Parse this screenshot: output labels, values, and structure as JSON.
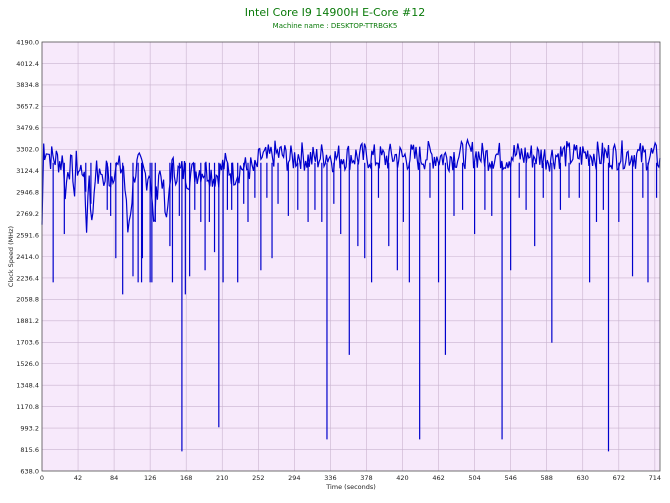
{
  "chart_data": {
    "type": "line",
    "title": "Intel Core I9 14900H E-Core #12",
    "subtitle": "Machine name : DESKTOP-TTRBGK5",
    "xlabel": "Time (seconds)",
    "ylabel": "Clock Speed (MHz)",
    "xlim": [
      0,
      720
    ],
    "ylim": [
      638.0,
      4190.0
    ],
    "x_ticks": [
      "0",
      "42",
      "84",
      "126",
      "168",
      "210",
      "252",
      "294",
      "336",
      "378",
      "420",
      "462",
      "504",
      "546",
      "588",
      "630",
      "672",
      "714"
    ],
    "y_ticks": [
      "638.0",
      "815.6",
      "993.2",
      "1170.8",
      "1348.4",
      "1526.0",
      "1703.6",
      "1881.2",
      "2058.8",
      "2236.4",
      "2414.0",
      "2591.6",
      "2769.2",
      "2946.8",
      "3124.4",
      "3302.0",
      "3479.6",
      "3657.2",
      "3834.8",
      "4012.4",
      "4190.0"
    ],
    "grid": true,
    "series": [
      {
        "color": "#0000cc",
        "baseline": 3190,
        "upper_level": 3300,
        "x": [
          0,
          2,
          3,
          5,
          7,
          10,
          14,
          18,
          22,
          25,
          27,
          30,
          32,
          36,
          38,
          40,
          44,
          48,
          52,
          55,
          58,
          62,
          67,
          70,
          72,
          75,
          80,
          84,
          90,
          95,
          100,
          108,
          112,
          116,
          122,
          126,
          130,
          136,
          140,
          145,
          150,
          160,
          166,
          170,
          178,
          185,
          194,
          200,
          206,
          212,
          218,
          222,
          228,
          234,
          240,
          248,
          255,
          262,
          270,
          280,
          290,
          300,
          310,
          320,
          330,
          340,
          350,
          360,
          370,
          380,
          390,
          400,
          410,
          420,
          430,
          440,
          450,
          460,
          470,
          480,
          490,
          500,
          510,
          520,
          530,
          540,
          550,
          560,
          570,
          580,
          590,
          600,
          610,
          620,
          630,
          640,
          650,
          660,
          670,
          680,
          690,
          700,
          710,
          720
        ],
        "y": [
          2210,
          3520,
          3460,
          3500,
          3400,
          3330,
          3300,
          3290,
          3240,
          3300,
          2600,
          3230,
          3170,
          3100,
          2700,
          3210,
          3080,
          3170,
          2200,
          3100,
          2150,
          3120,
          2950,
          3160,
          2800,
          3140,
          2970,
          3150,
          3130,
          3160,
          2100,
          3080,
          3190,
          3120,
          3000,
          3110,
          2150,
          3090,
          3000,
          2150,
          3150,
          3060,
          3100,
          3000,
          3080,
          3120,
          3100,
          3010,
          3060,
          3200,
          3140,
          3050,
          3100,
          3170,
          3080,
          3000,
          3250,
          3200,
          3290,
          3280,
          3200,
          3290,
          3210,
          3220,
          3300,
          3220,
          3260,
          3260,
          3250,
          3260,
          3220,
          3220,
          3260,
          3240,
          3250,
          3230,
          3280,
          3260,
          3240,
          3270,
          3280,
          3300,
          3270,
          3250,
          3280,
          3230,
          3290,
          3270,
          3260,
          3260,
          3240,
          3280,
          3290,
          3260,
          3280,
          3300,
          3260,
          3280,
          3270,
          3290,
          3280,
          3250,
          3270,
          3230
        ],
        "dips": [
          {
            "x": 13,
            "min": 2200
          },
          {
            "x": 26,
            "min": 2600
          },
          {
            "x": 51,
            "min": 2950
          },
          {
            "x": 57,
            "min": 2850
          },
          {
            "x": 76,
            "min": 2800
          },
          {
            "x": 80,
            "min": 2750
          },
          {
            "x": 86,
            "min": 2400
          },
          {
            "x": 94,
            "min": 2100
          },
          {
            "x": 106,
            "min": 2250
          },
          {
            "x": 112,
            "min": 2200
          },
          {
            "x": 116,
            "min": 2200
          },
          {
            "x": 117,
            "min": 2400
          },
          {
            "x": 126,
            "min": 2200
          },
          {
            "x": 128,
            "min": 2200
          },
          {
            "x": 132,
            "min": 2700
          },
          {
            "x": 149,
            "min": 2500
          },
          {
            "x": 152,
            "min": 2200
          },
          {
            "x": 160,
            "min": 2750
          },
          {
            "x": 163,
            "min": 800
          },
          {
            "x": 167,
            "min": 2100
          },
          {
            "x": 172,
            "min": 2250
          },
          {
            "x": 178,
            "min": 2800
          },
          {
            "x": 185,
            "min": 2700
          },
          {
            "x": 190,
            "min": 2300
          },
          {
            "x": 195,
            "min": 2700
          },
          {
            "x": 201,
            "min": 2450
          },
          {
            "x": 206,
            "min": 1000
          },
          {
            "x": 211,
            "min": 2200
          },
          {
            "x": 216,
            "min": 2800
          },
          {
            "x": 221,
            "min": 2800
          },
          {
            "x": 228,
            "min": 2200
          },
          {
            "x": 235,
            "min": 2850
          },
          {
            "x": 240,
            "min": 2700
          },
          {
            "x": 248,
            "min": 2900
          },
          {
            "x": 255,
            "min": 2300
          },
          {
            "x": 262,
            "min": 2900
          },
          {
            "x": 268,
            "min": 2400
          },
          {
            "x": 275,
            "min": 2850
          },
          {
            "x": 287,
            "min": 2750
          },
          {
            "x": 298,
            "min": 2800
          },
          {
            "x": 310,
            "min": 2700
          },
          {
            "x": 318,
            "min": 2800
          },
          {
            "x": 326,
            "min": 2700
          },
          {
            "x": 332,
            "min": 900
          },
          {
            "x": 340,
            "min": 2850
          },
          {
            "x": 348,
            "min": 2600
          },
          {
            "x": 358,
            "min": 1600
          },
          {
            "x": 368,
            "min": 2500
          },
          {
            "x": 376,
            "min": 2400
          },
          {
            "x": 384,
            "min": 2200
          },
          {
            "x": 392,
            "min": 2900
          },
          {
            "x": 404,
            "min": 2500
          },
          {
            "x": 414,
            "min": 2300
          },
          {
            "x": 421,
            "min": 2700
          },
          {
            "x": 428,
            "min": 2200
          },
          {
            "x": 440,
            "min": 900
          },
          {
            "x": 452,
            "min": 2900
          },
          {
            "x": 462,
            "min": 2200
          },
          {
            "x": 470,
            "min": 1600
          },
          {
            "x": 480,
            "min": 2750
          },
          {
            "x": 490,
            "min": 2800
          },
          {
            "x": 504,
            "min": 2600
          },
          {
            "x": 516,
            "min": 2800
          },
          {
            "x": 524,
            "min": 2750
          },
          {
            "x": 536,
            "min": 900
          },
          {
            "x": 546,
            "min": 2300
          },
          {
            "x": 556,
            "min": 2900
          },
          {
            "x": 564,
            "min": 2800
          },
          {
            "x": 574,
            "min": 2500
          },
          {
            "x": 584,
            "min": 2900
          },
          {
            "x": 594,
            "min": 1700
          },
          {
            "x": 604,
            "min": 2800
          },
          {
            "x": 614,
            "min": 2900
          },
          {
            "x": 626,
            "min": 2900
          },
          {
            "x": 638,
            "min": 2200
          },
          {
            "x": 646,
            "min": 2700
          },
          {
            "x": 654,
            "min": 2800
          },
          {
            "x": 660,
            "min": 800
          },
          {
            "x": 672,
            "min": 2700
          },
          {
            "x": 688,
            "min": 2250
          },
          {
            "x": 700,
            "min": 2900
          },
          {
            "x": 706,
            "min": 2200
          },
          {
            "x": 716,
            "min": 2900
          }
        ]
      }
    ]
  }
}
